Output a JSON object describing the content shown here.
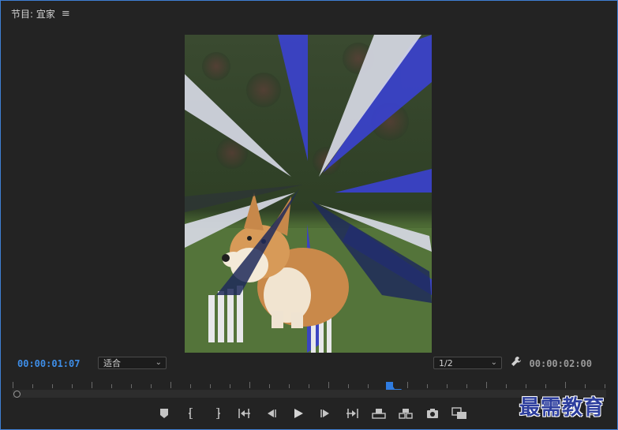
{
  "panel": {
    "title": "节目: 宜家",
    "menu_icon": "hamburger-menu-icon"
  },
  "timecode": {
    "current": "00:00:01:07",
    "duration": "00:00:02:00"
  },
  "fit_select": {
    "value": "适合"
  },
  "resolution_select": {
    "value": "1/2"
  },
  "playhead_position": 0.63,
  "accent_color": "#3e8ee8",
  "controls": [
    {
      "name": "add-marker-button",
      "icon": "marker-icon"
    },
    {
      "name": "mark-in-button",
      "icon": "mark-in-icon"
    },
    {
      "name": "mark-out-button",
      "icon": "mark-out-icon"
    },
    {
      "name": "go-to-in-button",
      "icon": "go-to-in-icon"
    },
    {
      "name": "step-back-button",
      "icon": "step-back-icon"
    },
    {
      "name": "play-button",
      "icon": "play-icon"
    },
    {
      "name": "step-forward-button",
      "icon": "step-forward-icon"
    },
    {
      "name": "go-to-out-button",
      "icon": "go-to-out-icon"
    },
    {
      "name": "lift-button",
      "icon": "lift-icon"
    },
    {
      "name": "extract-button",
      "icon": "extract-icon"
    },
    {
      "name": "export-frame-button",
      "icon": "camera-icon"
    },
    {
      "name": "comparison-view-button",
      "icon": "comparison-icon"
    }
  ],
  "watermark": "最需教育"
}
